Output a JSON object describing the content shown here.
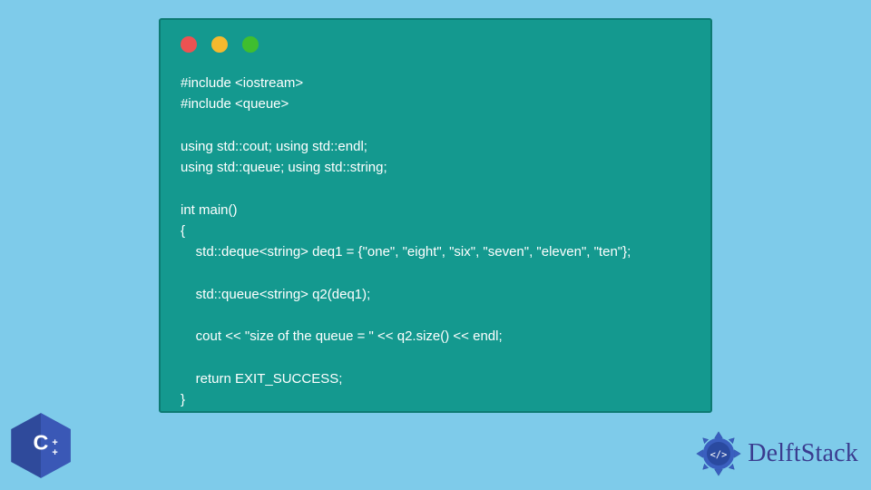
{
  "code": {
    "lines": [
      "#include <iostream>",
      "#include <queue>",
      "",
      "using std::cout; using std::endl;",
      "using std::queue; using std::string;",
      "",
      "int main()",
      "{",
      "    std::deque<string> deq1 = {\"one\", \"eight\", \"six\", \"seven\", \"eleven\", \"ten\"};",
      "",
      "    std::queue<string> q2(deq1);",
      "",
      "    cout << \"size of the queue = \" << q2.size() << endl;",
      "",
      "    return EXIT_SUCCESS;",
      "}"
    ]
  },
  "badges": {
    "cpp_label": "C++",
    "brand_name": "DelftStack"
  },
  "colors": {
    "page_bg": "#7ecbea",
    "window_bg": "#14998f",
    "window_border": "#0d7a72",
    "dot_red": "#ec5252",
    "dot_yellow": "#f5b92e",
    "dot_green": "#3fbe2f",
    "code_text": "#ffffff",
    "brand_text": "#3a3c8f",
    "cpp_badge": "#2f4a9b"
  }
}
